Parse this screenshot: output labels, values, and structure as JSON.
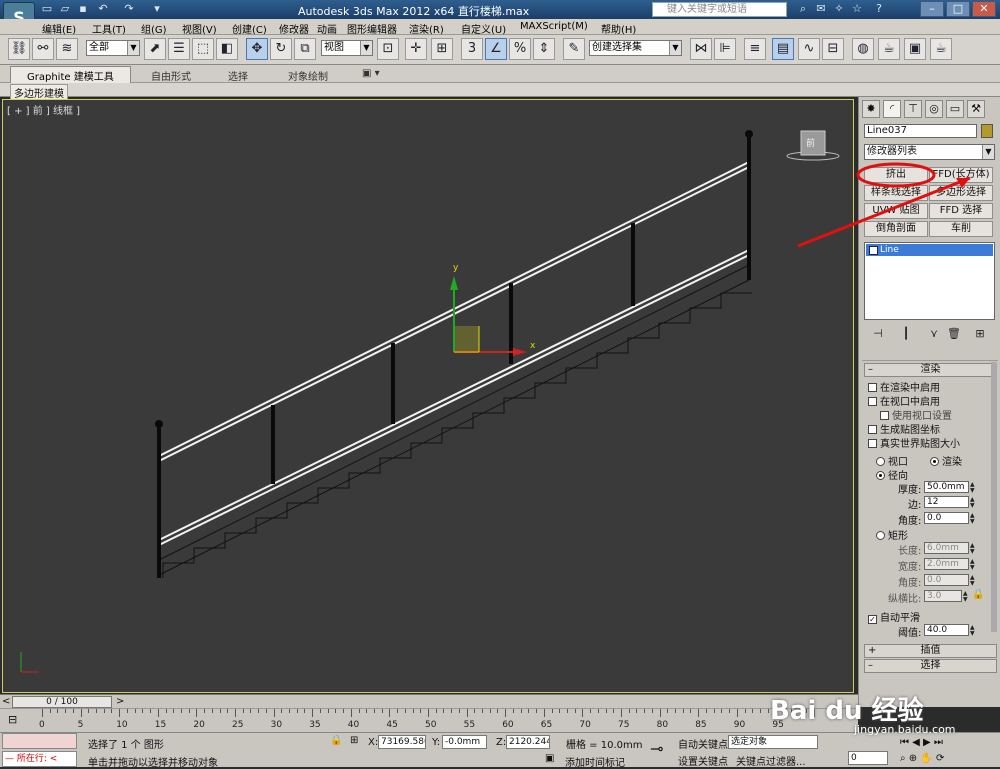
{
  "titlebar": {
    "title": "Autodesk 3ds Max  2012 x64       直行楼梯.max",
    "search_placeholder": "键入关键字或短语",
    "app_logo": "3ds-max-logo"
  },
  "menubar": {
    "items": [
      "编辑(E)",
      "工具(T)",
      "组(G)",
      "视图(V)",
      "创建(C)",
      "修改器",
      "动画",
      "图形编辑器",
      "渲染(R)",
      "自定义(U)",
      "MAXScript(M)",
      "帮助(H)"
    ]
  },
  "toolbar": {
    "selection_filter": "全部",
    "reference_coord": "视图",
    "named_selection": "创建选择集"
  },
  "ribbon": {
    "tabs": [
      "Graphite 建模工具",
      "自由形式",
      "选择",
      "对象绘制"
    ],
    "sub_tab": "多边形建模"
  },
  "viewport": {
    "label": "[ + ] 前 ] 线框 ]",
    "viewcube_label": "前"
  },
  "command_panel": {
    "object_name": "Line037",
    "object_color": "#b39a2a",
    "modifier_list": "修改器列表",
    "modifier_buttons": [
      "挤出",
      "FFD(长方体)",
      "样条线选择",
      "多边形选择",
      "UVW 贴图",
      "FFD 选择",
      "倒角剖面",
      "车削"
    ],
    "stack_items": [
      "Line"
    ],
    "rendering": {
      "title": "渲染",
      "enable_in_renderer": "在渲染中启用",
      "enable_in_viewport": "在视口中启用",
      "use_viewport_settings": "使用视口设置",
      "gen_mapping": "生成贴图坐标",
      "real_world": "真实世界贴图大小",
      "viewport_radio": "视口",
      "render_radio": "渲染",
      "radial": "径向",
      "thickness_label": "厚度:",
      "thickness": "50.0mm",
      "sides_label": "边:",
      "sides": "12",
      "angle_label": "角度:",
      "angle": "0.0",
      "rectangular": "矩形",
      "length_label": "长度:",
      "length": "6.0mm",
      "width_label": "宽度:",
      "width": "2.0mm",
      "angle2_label": "角度:",
      "angle2": "0.0",
      "aspect_label": "纵横比:",
      "aspect": "3.0",
      "auto_smooth": "自动平滑",
      "threshold_label": "阈值:",
      "threshold": "40.0"
    },
    "interpolation": "插值",
    "selection": "选择"
  },
  "timeline": {
    "frame": "0 / 100",
    "ticks": [
      "0",
      "5",
      "10",
      "15",
      "20",
      "25",
      "30",
      "35",
      "40",
      "45",
      "50",
      "55",
      "60",
      "65",
      "70",
      "75",
      "80",
      "85",
      "90",
      "95"
    ]
  },
  "statusbar": {
    "maxscript_label": "所在行:",
    "status_line1": "选择了 1 个 图形",
    "status_line2": "单击并拖动以选择并移动对象",
    "x_label": "X:",
    "x_value": "73169.586",
    "y_label": "Y:",
    "y_value": "-0.0mm",
    "z_label": "Z:",
    "z_value": "2120.244",
    "grid": "栅格 = 10.0mm",
    "add_time_tag": "添加时间标记",
    "auto_key": "自动关键点",
    "set_key": "设置关键点",
    "selected_object": "选定对象",
    "key_filter": "关键点过滤器...",
    "current_frame": "0"
  },
  "watermark": {
    "brand": "Bai du 经验",
    "url": "jingyan.baidu.com"
  }
}
